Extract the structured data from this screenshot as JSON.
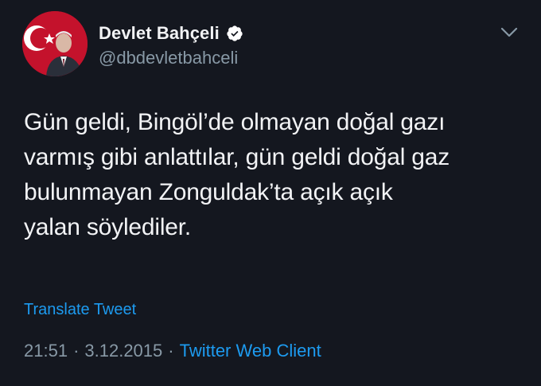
{
  "tweet": {
    "author": {
      "display_name": "Devlet Bahçeli",
      "handle": "@dbdevletbahceli",
      "verified": true,
      "avatar_icon": "avatar-photo"
    },
    "menu_icon": "chevron-down-icon",
    "text": "Gün geldi, Bingöl’de olmayan doğal gazı\nvarmış gibi anlattılar, gün geldi doğal gaz\nbulunmayan Zonguldak’ta açık açık\nyalan söylediler.",
    "translate_label": "Translate Tweet",
    "time": "21:51",
    "date": "3.12.2015",
    "separator": "·",
    "client": "Twitter Web Client"
  },
  "colors": {
    "background": "#14171f",
    "text_primary": "#f2f3f5",
    "text_secondary": "#8899a6",
    "accent": "#1d9bf0"
  }
}
